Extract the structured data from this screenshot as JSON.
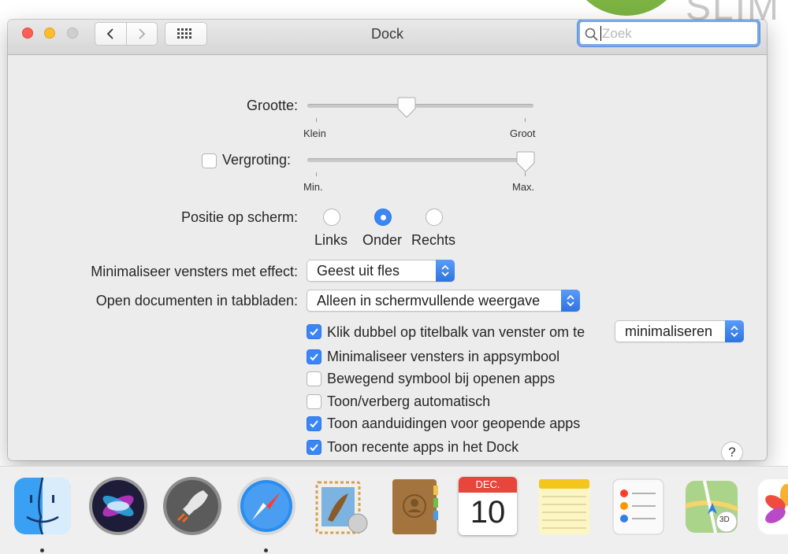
{
  "window": {
    "title": "Dock",
    "search_placeholder": "Zoek"
  },
  "size": {
    "label": "Grootte:",
    "min_label": "Klein",
    "max_label": "Groot",
    "value": 0.43
  },
  "magnification": {
    "label": "Vergroting:",
    "checked": false,
    "min_label": "Min.",
    "max_label": "Max.",
    "value": 1.0
  },
  "position": {
    "label": "Positie op scherm:",
    "options": [
      "Links",
      "Onder",
      "Rechts"
    ],
    "selected": "Onder"
  },
  "minimize_effect": {
    "label": "Minimaliseer vensters met effect:",
    "value": "Geest uit fles"
  },
  "open_tabs": {
    "label": "Open documenten in tabbladen:",
    "value": "Alleen in schermvullende weergave"
  },
  "double_click": {
    "label": "Klik dubbel op titelbalk van venster om te",
    "checked": true,
    "value": "minimaliseren"
  },
  "options": [
    {
      "label": "Minimaliseer vensters in appsymbool",
      "checked": true
    },
    {
      "label": "Bewegend symbool bij openen apps",
      "checked": false
    },
    {
      "label": "Toon/verberg automatisch",
      "checked": false
    },
    {
      "label": "Toon aanduidingen voor geopende apps",
      "checked": true
    },
    {
      "label": "Toon recente apps in het Dock",
      "checked": true
    }
  ],
  "help_label": "?",
  "dock": {
    "apps": [
      "Finder",
      "Siri",
      "Launchpad",
      "Safari",
      "Mail",
      "Contacten",
      "Agenda",
      "Notities",
      "Herinneringen",
      "Kaarten",
      "Foto's"
    ],
    "calendar_month": "DEC.",
    "calendar_day": "10",
    "maps_badge": "3D"
  },
  "colors": {
    "accent": "#3b86f7",
    "close": "#fd5f57",
    "minimize": "#febc2e"
  }
}
